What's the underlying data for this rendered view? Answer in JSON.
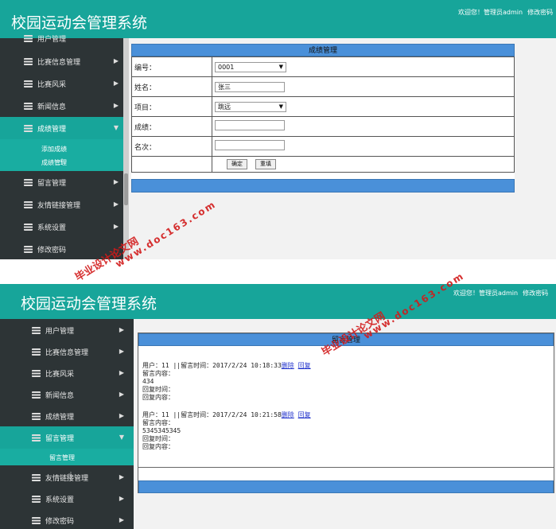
{
  "app": {
    "title": "校园运动会管理系统"
  },
  "header": {
    "welcome": "欢迎您！管理员admin",
    "change_password_link": "修改密码"
  },
  "shot1": {
    "sidebar": {
      "items": [
        {
          "label": "用户管理"
        },
        {
          "label": "比赛信息管理"
        },
        {
          "label": "比赛风采"
        },
        {
          "label": "新闻信息"
        },
        {
          "label": "成绩管理"
        },
        {
          "label": "留言管理"
        },
        {
          "label": "友情链接管理"
        },
        {
          "label": "系统设置"
        },
        {
          "label": "修改密码"
        }
      ],
      "submenu": [
        {
          "label": "添加成绩"
        },
        {
          "label": "成绩管理"
        }
      ]
    },
    "panel": {
      "title": "成绩管理",
      "fields": {
        "number_label": "编号：",
        "number_value": "0001",
        "name_label": "姓名：",
        "name_value": "张三",
        "event_label": "项目：",
        "event_value": "跳远",
        "score_label": "成绩：",
        "score_value": "",
        "rank_label": "名次：",
        "rank_value": ""
      },
      "confirm_button": "确定",
      "reset_button": "重填"
    }
  },
  "shot2": {
    "sidebar": {
      "items": [
        {
          "label": "用户管理"
        },
        {
          "label": "比赛信息管理"
        },
        {
          "label": "比赛风采"
        },
        {
          "label": "新闻信息"
        },
        {
          "label": "成绩管理"
        },
        {
          "label": "留言管理"
        },
        {
          "label": "友情链接管理"
        },
        {
          "label": "系统设置"
        },
        {
          "label": "修改密码"
        }
      ],
      "submenu": [
        {
          "label": "留言管理"
        }
      ]
    },
    "panel": {
      "title": "留言管理",
      "messages": [
        {
          "header": "用户：11 ||留言时间：2017/2/24 10:18:33",
          "delete": "删除",
          "reply": "回复",
          "content_label": "留言内容：",
          "content": "434",
          "reply_time_label": "回复时间：",
          "reply_content_label": "回复内容："
        },
        {
          "header": "用户：11 ||留言时间：2017/2/24 10:21:58",
          "delete": "删除",
          "reply": "回复",
          "content_label": "留言内容：",
          "content": "5345345345",
          "reply_time_label": "回复时间：",
          "reply_content_label": "回复内容："
        }
      ]
    }
  },
  "watermarks": {
    "site_name": "毕业设计论文网",
    "url": "www.doc163.com"
  },
  "colors": {
    "header_bg": "#17a59a",
    "sidebar_bg": "#2d3436",
    "panel_blue": "#4a90d9",
    "watermark_red": "#d21a1a"
  }
}
